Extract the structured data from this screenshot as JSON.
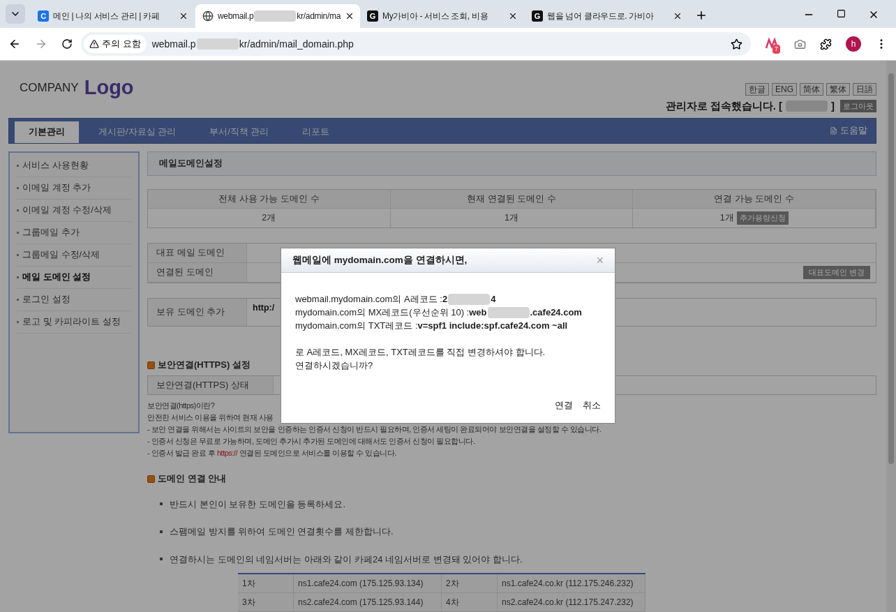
{
  "browser": {
    "tabs": [
      {
        "title": "메인 | 나의 서비스 관리 | 카페",
        "favicon": {
          "kind": "letter",
          "text": "C",
          "color": "#1a73e8"
        },
        "selected": false
      },
      {
        "title": "webmail.p",
        "title_tail": "kr/admin/ma",
        "favicon": {
          "kind": "globe"
        },
        "selected": true
      },
      {
        "title": "My가비아 - 서비스 조회, 비용",
        "favicon": {
          "kind": "letter",
          "text": "G",
          "color": "#111111"
        },
        "selected": false
      },
      {
        "title": "웹을 넘어 클라우드로. 가비아",
        "favicon": {
          "kind": "letter",
          "text": "G",
          "color": "#111111"
        },
        "selected": false
      }
    ],
    "security": "주의 요함",
    "url": "webmail.p",
    "url_tail": "kr/admin/mail_domain.php",
    "extension_badge": "7",
    "profile": "h"
  },
  "header": {
    "company": "COMPANY",
    "logo": "Logo",
    "languages": [
      "한글",
      "ENG",
      "简体",
      "繁体",
      "日語"
    ],
    "admin_text": "관리자로 접속했습니다. [",
    "admin_close": "]",
    "logout": "로그아웃"
  },
  "nav": {
    "tabs": [
      {
        "label": "기본관리",
        "selected": true
      },
      {
        "label": "게시판/자료실 관리",
        "selected": false
      },
      {
        "label": "부서/직책 관리",
        "selected": false
      },
      {
        "label": "리포트",
        "selected": false
      }
    ],
    "help": "도움말"
  },
  "sidebar": {
    "items": [
      {
        "label": "서비스 사용현황",
        "selected": false
      },
      {
        "label": "이메일 계정 추가",
        "selected": false
      },
      {
        "label": "이메일 계정 수정/삭제",
        "selected": false
      },
      {
        "label": "그룹메일 추가",
        "selected": false
      },
      {
        "label": "그룹메일 수정/삭제",
        "selected": false
      },
      {
        "label": "메일 도메인 설정",
        "selected": true
      },
      {
        "label": "로그인 설정",
        "selected": false
      },
      {
        "label": "로고 및 카피라이트 설정",
        "selected": false
      }
    ]
  },
  "main": {
    "title": "메일도메인설정",
    "stats": {
      "columns": [
        "전체 사용 가능 도메인 수",
        "현재 연결된 도메인 수",
        "연결 가능 도메인 수"
      ],
      "values": [
        "2개",
        "1개",
        "1개"
      ],
      "button": "추가용량신청"
    },
    "domains": [
      {
        "label": "대표 메일 도메인"
      },
      {
        "label": "연결된 도메인",
        "button": "대표도메인 변경"
      }
    ],
    "add_domain": {
      "label": "보유 도메인 추가",
      "value": "http:/"
    },
    "https": {
      "heading": "보안연결(HTTPS) 설정",
      "label": "보안연결(HTTPS) 상태",
      "note_title": "보안연결(https)이란?",
      "lines": [
        {
          "text": "안전한 서비스 이용을 위하여 현재 사용"
        },
        {
          "text": "- 보안 연결을 위해서는 사이트의 보안을 인증하는 인증서 신청이 반드시 필요하며, 인증서 세팅이 완료되어야 보안연결을 설정할 수 있습니다."
        },
        {
          "text": "- 인증서 신청은 무료로 가능하며, 도메인 추가시 추가된 도메인에 대해서도 인증서 신청이 필요합니다."
        },
        {
          "text": "- 인증서 발급 완료 후 ",
          "link": "https://",
          "after": " 연결된 도메인으로 서비스를 이용할 수 있습니다."
        }
      ]
    },
    "guide": {
      "heading": "도메인 연결 안내",
      "bullets": [
        "반드시 본인이 보유한 도메인을 등록하세요.",
        "스팸메일 방지를 위하여 도메인 연결횟수를 제한합니다.",
        "연결하시는 도메인의 네임서버는 아래와 같이 카페24 네임서버로 변경돼 있어야 합니다."
      ],
      "nameservers": [
        [
          "1차",
          "ns1.cafe24.com (175.125.93.134)",
          "2차",
          "ns1.cafe24.co.kr (112.175.246.232)"
        ],
        [
          "3차",
          "ns2.cafe24.com (175.125.93.144)",
          "4차",
          "ns2.cafe24.co.kr (112.175.247.232)"
        ]
      ]
    }
  },
  "dialog": {
    "title": "웹메일에 mydomain.com을 연결하시면,",
    "close": "×",
    "records": [
      {
        "label": "webmail.mydomain.com의 A레코드 : ",
        "value": "2",
        "value_tail": "4"
      },
      {
        "label": "mydomain.com의 MX레코드(우선순위 10) : ",
        "value": "web",
        "value_tail": ".cafe24.com"
      },
      {
        "label": "mydomain.com의 TXT레코드 : ",
        "value": "v=spf1 include:spf.cafe24.com ~all"
      }
    ],
    "message": "로 A레코드, MX레코드, TXT레코드를 직접 변경하셔야 합니다.",
    "question": "연결하시겠습니까?",
    "buttons": [
      "연결",
      "취소"
    ]
  }
}
